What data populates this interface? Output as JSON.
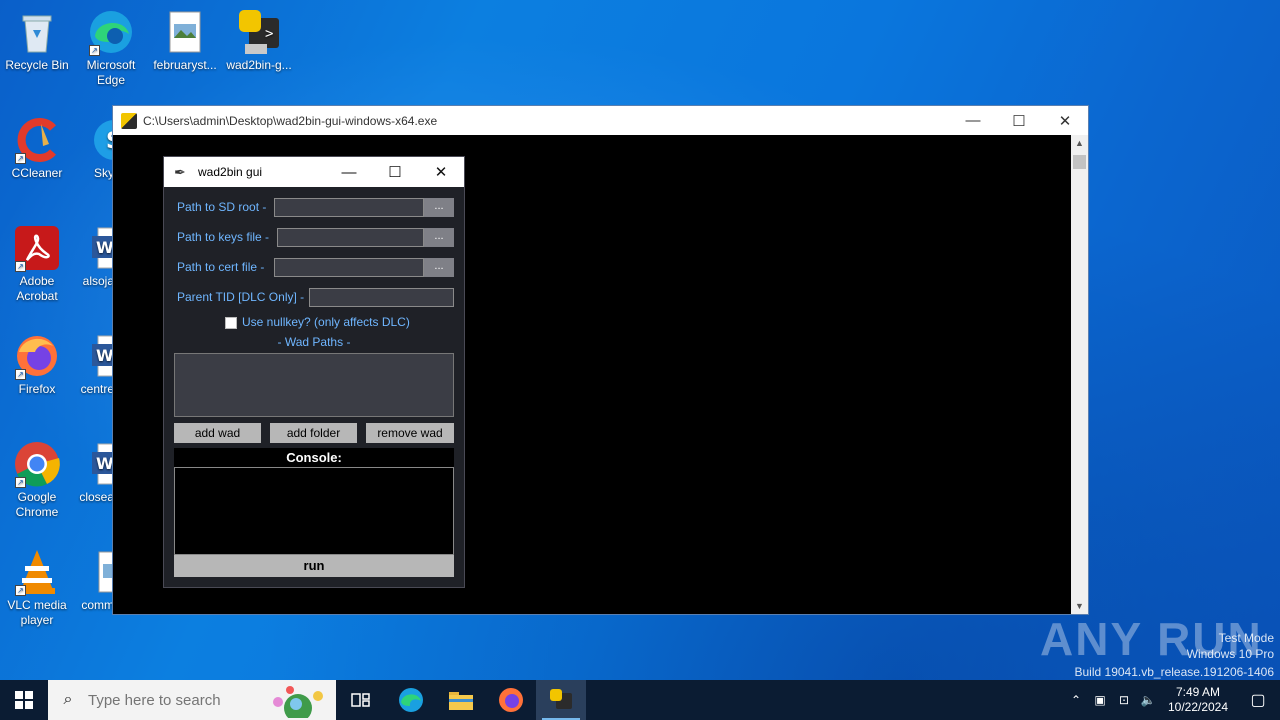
{
  "desktop": {
    "icons": [
      {
        "label": "Recycle Bin"
      },
      {
        "label": "Microsoft Edge"
      },
      {
        "label": "februaryst..."
      },
      {
        "label": "wad2bin-g..."
      },
      {
        "label": "CCleaner"
      },
      {
        "label": "Sky"
      },
      {
        "label": "Adobe Acrobat"
      },
      {
        "label": "alsoja"
      },
      {
        "label": "Firefox"
      },
      {
        "label": "centre"
      },
      {
        "label": "Google Chrome"
      },
      {
        "label": "closea"
      },
      {
        "label": "VLC media player"
      },
      {
        "label": "comm"
      }
    ]
  },
  "console_window": {
    "title": "C:\\Users\\admin\\Desktop\\wad2bin-gui-windows-x64.exe",
    "minimize": "—",
    "maximize": "☐",
    "close": "✕"
  },
  "gui_window": {
    "title": "wad2bin gui",
    "minimize": "—",
    "maximize": "☐",
    "close": "✕",
    "sd_root_label": "Path to SD root -",
    "keys_label": "Path to keys file -",
    "cert_label": "Path to cert file -",
    "browse_label": "...",
    "parent_tid_label": "Parent TID [DLC Only] -",
    "nullkey_label": "Use nullkey? (only affects DLC)",
    "wad_paths_label": "- Wad Paths -",
    "add_wad": "add wad",
    "add_folder": "add folder",
    "remove_wad": "remove wad",
    "console_label": "Console:",
    "run": "run"
  },
  "watermark": {
    "brand": "ANY RUN",
    "line1": "Test Mode",
    "line2": "Windows 10 Pro",
    "line3": "Build 19041.vb_release.191206-1406"
  },
  "taskbar": {
    "search_placeholder": "Type here to search",
    "time": "7:49 AM",
    "date": "10/22/2024"
  },
  "colors": {
    "desktop_blue": "#0a76dd",
    "gui_bg": "#1f2127",
    "label_blue": "#6fb6ff",
    "taskbar": "#0b1c33"
  }
}
